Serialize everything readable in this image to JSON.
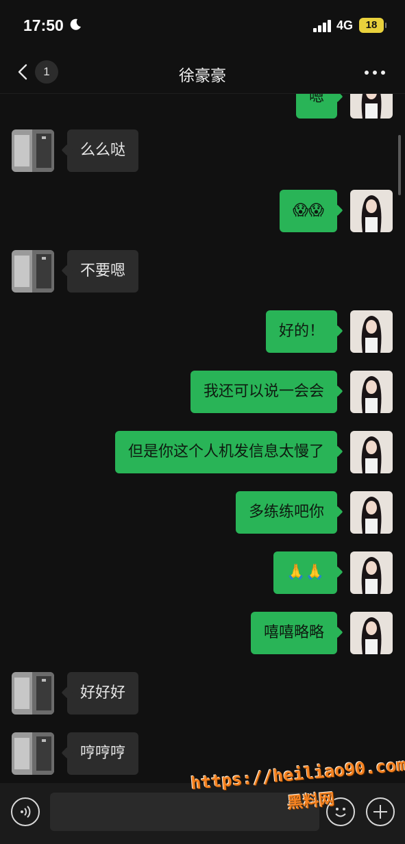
{
  "status_bar": {
    "time": "17:50",
    "network": "4G",
    "battery": "18",
    "icons": [
      "moon-icon",
      "signal-icon",
      "battery-icon"
    ]
  },
  "nav": {
    "unread_count": "1",
    "title": "徐豪豪",
    "icons": [
      "chevron-left-icon",
      "more-icon"
    ]
  },
  "messages": [
    {
      "side": "out",
      "text": "嗯"
    },
    {
      "side": "in",
      "text": "么么哒"
    },
    {
      "side": "out",
      "text": "😱😱"
    },
    {
      "side": "in",
      "text": "不要嗯"
    },
    {
      "side": "out",
      "text": "好的！"
    },
    {
      "side": "out",
      "text": "我还可以说一会会"
    },
    {
      "side": "out",
      "text": "但是你这个人机发信息太慢了"
    },
    {
      "side": "out",
      "text": "多练练吧你"
    },
    {
      "side": "out",
      "text": "🙏🙏"
    },
    {
      "side": "out",
      "text": "嘻嘻略略"
    },
    {
      "side": "in",
      "text": "好好好"
    },
    {
      "side": "in",
      "text": "哼哼哼"
    }
  ],
  "input_bar": {
    "icons": [
      "voice-icon",
      "emoji-icon",
      "plus-icon"
    ]
  },
  "watermark": {
    "url": "https://heiliao90.com",
    "name": "黑料网"
  },
  "colors": {
    "background": "#111111",
    "incoming_bubble": "#2c2c2c",
    "outgoing_bubble": "#29b457",
    "watermark": "#f58220"
  }
}
